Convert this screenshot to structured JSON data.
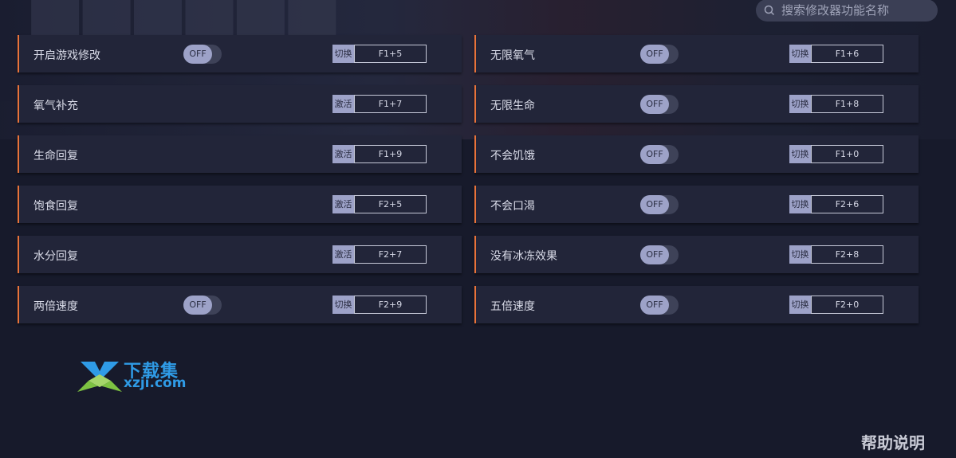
{
  "search": {
    "placeholder": "搜索修改器功能名称"
  },
  "toggle_text": "OFF",
  "rows": [
    {
      "label": "开启游戏修改",
      "toggle": true,
      "kind": "切换",
      "hotkey": "F1+5"
    },
    {
      "label": "无限氧气",
      "toggle": true,
      "kind": "切换",
      "hotkey": "F1+6"
    },
    {
      "label": "氧气补充",
      "toggle": false,
      "kind": "激活",
      "hotkey": "F1+7"
    },
    {
      "label": "无限生命",
      "toggle": true,
      "kind": "切换",
      "hotkey": "F1+8"
    },
    {
      "label": "生命回复",
      "toggle": false,
      "kind": "激活",
      "hotkey": "F1+9"
    },
    {
      "label": "不会饥饿",
      "toggle": true,
      "kind": "切换",
      "hotkey": "F1+0"
    },
    {
      "label": "饱食回复",
      "toggle": false,
      "kind": "激活",
      "hotkey": "F2+5"
    },
    {
      "label": "不会口渴",
      "toggle": true,
      "kind": "切换",
      "hotkey": "F2+6"
    },
    {
      "label": "水分回复",
      "toggle": false,
      "kind": "激活",
      "hotkey": "F2+7"
    },
    {
      "label": "没有冰冻效果",
      "toggle": true,
      "kind": "切换",
      "hotkey": "F2+8"
    },
    {
      "label": "两倍速度",
      "toggle": true,
      "kind": "切换",
      "hotkey": "F2+9"
    },
    {
      "label": "五倍速度",
      "toggle": true,
      "kind": "切换",
      "hotkey": "F2+0"
    }
  ],
  "logo": {
    "name": "下载集",
    "domain": "xzji.com"
  },
  "help_label": "帮助说明",
  "colors": {
    "accent": "#e8733a",
    "brand": "#2f9be6",
    "background": "#171a2b",
    "card": "#222539"
  }
}
